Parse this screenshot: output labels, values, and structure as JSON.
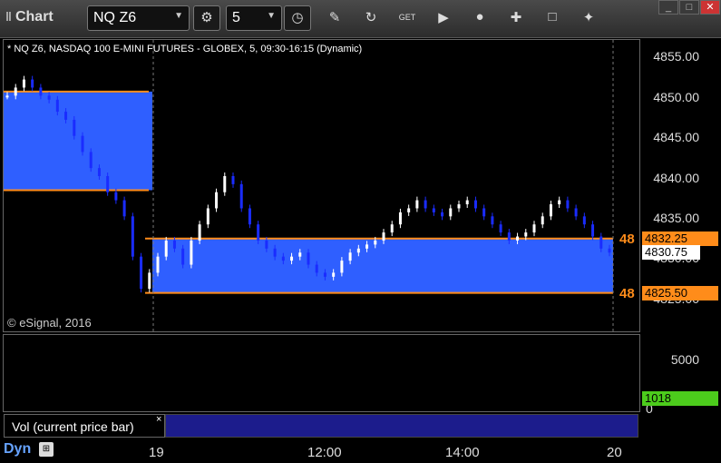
{
  "toolbar": {
    "title": "Chart",
    "symbol": "NQ Z6",
    "interval": "5",
    "icons": [
      "settings-icon",
      "clock-icon",
      "pencil-icon",
      "refresh-icon",
      "get-icon",
      "play-icon",
      "bell-icon",
      "insert-icon",
      "comment-icon",
      "twitter-icon"
    ]
  },
  "chart": {
    "label": "* NQ Z6, NASDAQ 100 E-MINI FUTURES - GLOBEX, 5, 09:30-16:15 (Dynamic)",
    "copyright": "© eSignal, 2016",
    "y_ticks": [
      "4855.00",
      "4850.00",
      "4845.00",
      "4840.00",
      "4835.00",
      "4830.00",
      "4825.00"
    ],
    "price_tags": {
      "upper": "4832.25",
      "current": "4830.75",
      "lower": "4825.50"
    },
    "left_tag_prefix": "48",
    "colors": {
      "band": "#2f5fff",
      "orange": "#ff8c1a",
      "up": "#ffffff",
      "down": "#1a2cff",
      "vol_up": "#39c639",
      "vol_down": "#d22020"
    }
  },
  "volume": {
    "title": "Vol (current price bar)",
    "close_label": "×",
    "y_ticks": [
      "5000",
      "0"
    ],
    "current": "1018"
  },
  "xaxis": {
    "dyn_label": "Dyn",
    "ticks": [
      "19",
      "12:00",
      "14:00",
      "20"
    ]
  },
  "chart_data": {
    "type": "candlestick",
    "ylim": [
      4823,
      4857
    ],
    "levels": [
      4850.5,
      4838.25,
      4832.25,
      4825.5
    ]
  }
}
